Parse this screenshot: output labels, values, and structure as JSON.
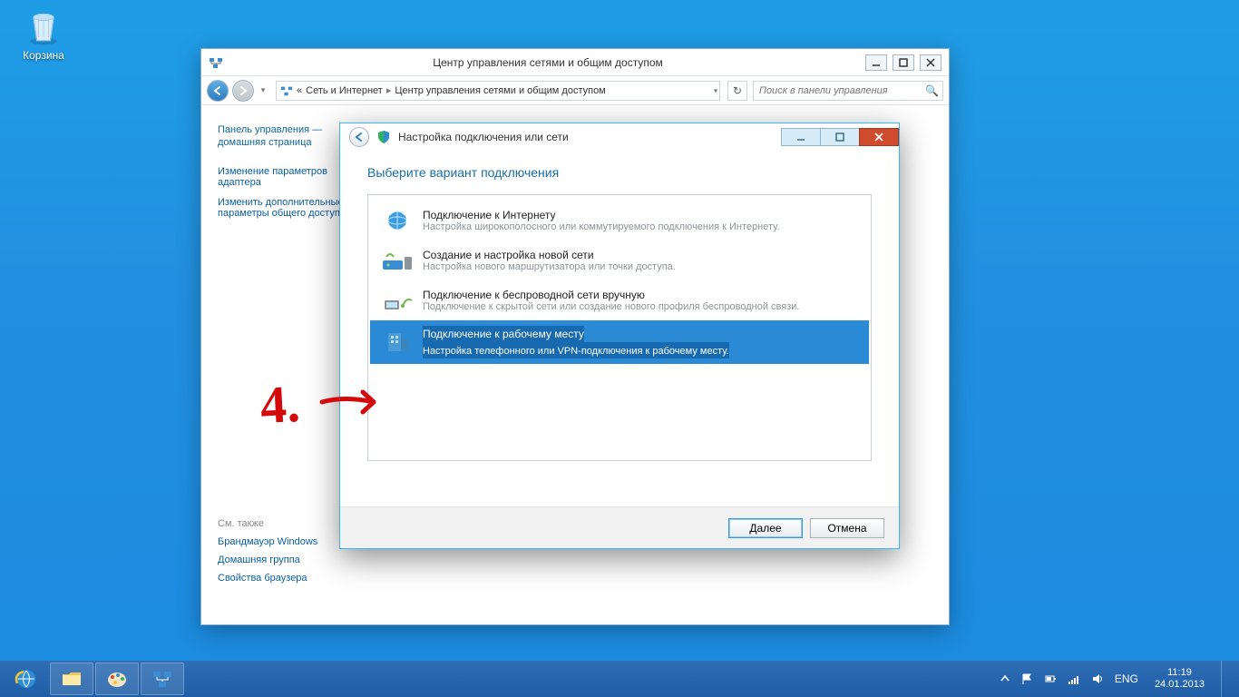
{
  "desktop": {
    "recycle_bin_label": "Корзина"
  },
  "cp_window": {
    "title": "Центр управления сетями и общим доступом",
    "breadcrumb_prefix": "«",
    "breadcrumb": [
      "Сеть и Интернет",
      "Центр управления сетями и общим доступом"
    ],
    "search_placeholder": "Поиск в панели управления",
    "side": {
      "home": "Панель управления — домашняя страница",
      "link1": "Изменение параметров адаптера",
      "link2": "Изменить дополнительные параметры общего доступа",
      "see_also": "См. также",
      "see1": "Брандмауэр Windows",
      "see2": "Домашняя группа",
      "see3": "Свойства браузера"
    }
  },
  "wizard": {
    "title": "Настройка подключения или сети",
    "headline": "Выберите вариант подключения",
    "options": [
      {
        "title": "Подключение к Интернету",
        "desc": "Настройка широкополосного или коммутируемого подключения к Интернету.",
        "selected": false
      },
      {
        "title": "Создание и настройка новой сети",
        "desc": "Настройка нового маршрутизатора или точки доступа.",
        "selected": false
      },
      {
        "title": "Подключение к беспроводной сети вручную",
        "desc": "Подключение к скрытой сети или создание нового профиля беспроводной связи.",
        "selected": false
      },
      {
        "title": "Подключение к рабочему месту",
        "desc": "Настройка телефонного или VPN-подключения к рабочему месту.",
        "selected": true
      }
    ],
    "buttons": {
      "next": "Далее",
      "cancel": "Отмена"
    }
  },
  "annotation": {
    "number": "4."
  },
  "tray": {
    "lang": "ENG",
    "time": "11:19",
    "date": "24.01.2013"
  }
}
